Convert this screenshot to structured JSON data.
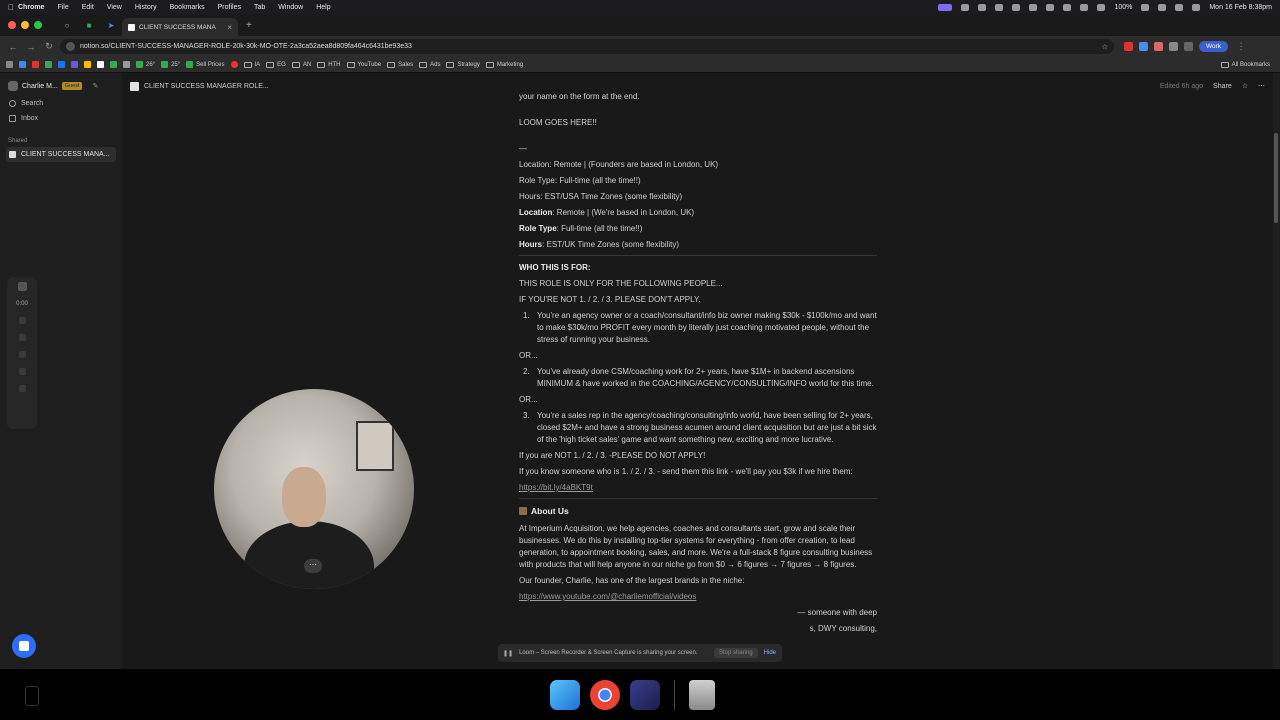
{
  "menubar": {
    "app": "Chrome",
    "items": [
      "File",
      "Edit",
      "View",
      "History",
      "Bookmarks",
      "Profiles",
      "Tab",
      "Window",
      "Help"
    ],
    "battery": "100%",
    "clock": "Mon 16 Feb  8:38pm"
  },
  "browser": {
    "tab_title": "CLIENT SUCCESS MANA",
    "url": "notion.so/CLIENT-SUCCESS-MANAGER-ROLE-20k-30k-MO-OTE-2a3ca52aea8d809fa464c6431be93e33",
    "profile_label": "Work",
    "bookmarks": [
      "26°",
      "25°",
      "Sell Prices",
      "IA",
      "EG",
      "AN",
      "HTH",
      "YouTube",
      "Sales",
      "Ads",
      "Strategy",
      "Marketing"
    ],
    "all_bookmarks": "All Bookmarks"
  },
  "sidebar": {
    "workspace": "Charlie M...",
    "badge": "Guest",
    "search": "Search",
    "inbox": "Inbox",
    "shared_label": "Shared",
    "shared_page": "CLIENT SUCCESS MANA..."
  },
  "loom_controls": {
    "timer": "0:00"
  },
  "page": {
    "breadcrumb": "CLIENT SUCCESS MANAGER ROLE...",
    "edited": "Edited 6h ago",
    "share": "Share",
    "intro_line": "your name on the form at the end.",
    "loom": "LOOM GOES HERE!!",
    "dash": "—",
    "details_a": [
      "Location: Remote | (Founders are based in London, UK)",
      "Role Type: Full-time (all the time!!)",
      "Hours: EST/USA Time Zones (some flexibility)"
    ],
    "details_b": {
      "location_label": "Location",
      "location_value": ": Remote | (We're based in London, UK)",
      "role_label": "Role Type",
      "role_value": ": Full-time (all the time!!)",
      "hours_label": "Hours",
      "hours_value": ": EST/UK Time Zones (some flexibility)"
    },
    "who_heading": "WHO THIS IS FOR:",
    "who_line1": "THIS ROLE IS ONLY FOR THE FOLLOWING PEOPLE...",
    "who_line2": "IF YOU'RE NOT 1. / 2. / 3. PLEASE DON'T APPLY.",
    "list": [
      {
        "num": "1.",
        "text": "You're an agency owner or a coach/consultant/info biz owner making $30k - $100k/mo and want to make $30k/mo PROFIT every month by literally just coaching motivated people, without the stress of running your business."
      },
      {
        "num": "2.",
        "text": "You've already done CSM/coaching work for 2+ years, have $1M+ in backend ascensions MINIMUM & have worked in the COACHING/AGENCY/CONSULTING/INFO world for this time."
      },
      {
        "num": "3.",
        "text": "You're a sales rep in the agency/coaching/consulting/info world, have been selling for 2+ years, closed $2M+ and have a strong business acumen around client acquisition but are just a bit sick of the 'high ticket sales' game and want something new, exciting and more lucrative."
      }
    ],
    "or_label": "OR...",
    "not_apply": "If you are NOT 1. / 2. / 3. -PLEASE DO NOT APPLY!",
    "referral": "If you know someone who is 1. / 2. / 3. - send them this link - we'll pay you $3k if we hire them:",
    "referral_link": "https://bit.ly/4aBKT9t",
    "about_heading": "About Us",
    "about_text": "At Imperium Acquisition, we help agencies, coaches and consultants start, grow and scale their businesses. We do this by installing top-tier systems for everything - from offer creation, to lead generation, to appointment booking, sales, and more. We're a full-stack 8 figure consulting business with products that will help anyone in our niche go from $0 → 6 figures → 7 figures → 8 figures.",
    "founder_line": "Our founder, Charlie, has one of the largest brands in the niche:",
    "founder_link": "https://www.youtube.com/@charliemofficial/videos",
    "cut_line1": "— someone with deep",
    "cut_line2": "s, DWY consulting,"
  },
  "share_bar": {
    "message": "Loom – Screen Recorder & Screen Capture is sharing your screen.",
    "stop": "Stop sharing",
    "hide": "Hide"
  },
  "colors": {
    "accent": "#2f6df6",
    "background": "#191919",
    "text": "#d0d0d0"
  }
}
